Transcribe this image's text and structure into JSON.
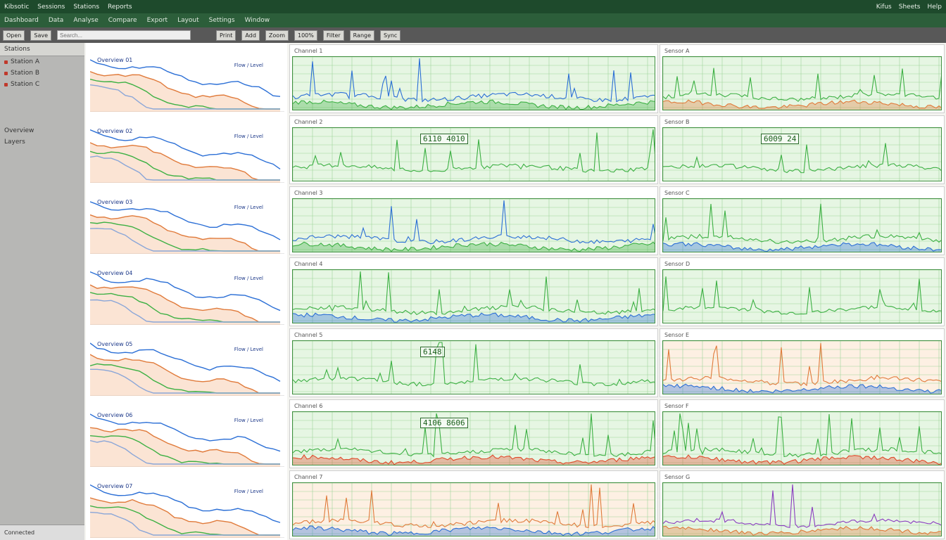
{
  "window": {
    "app_name": "Kibsotic",
    "tabs": [
      "Sessions",
      "Stations",
      "Reports"
    ],
    "right_items": [
      "Kifus",
      "Sheets",
      "Help"
    ]
  },
  "menubar": {
    "items": [
      "Dashboard",
      "Data",
      "Analyse",
      "Compare",
      "Export",
      "Layout",
      "Settings",
      "Window"
    ]
  },
  "toolbar": {
    "search_placeholder": "Search...",
    "buttons": [
      "Open",
      "Save",
      "Print",
      "Add",
      "Zoom",
      "Filter",
      "Range",
      "Sync"
    ],
    "zoom_value": "100%"
  },
  "sidebar": {
    "sections": [
      "Stations"
    ],
    "items": [
      "Station A",
      "Station B",
      "Station C",
      "Overview",
      "Layers"
    ],
    "footer": "Connected"
  },
  "thumbnails": [
    {
      "title": "Overview 01",
      "right": "Flow / Level"
    },
    {
      "title": "Overview 02",
      "right": "Flow / Level"
    },
    {
      "title": "Overview 03",
      "right": "Flow / Level"
    },
    {
      "title": "Overview 04",
      "right": "Flow / Level"
    },
    {
      "title": "Overview 05",
      "right": "Flow / Level"
    },
    {
      "title": "Overview 06",
      "right": "Flow / Level"
    },
    {
      "title": "Overview 07",
      "right": "Flow / Level"
    }
  ],
  "center_panels": [
    {
      "title": "Channel 1",
      "overlay": "",
      "colors": [
        "#2b6fd6",
        "#3cb043"
      ]
    },
    {
      "title": "Channel 2",
      "overlay": "6110  4010",
      "colors": [
        "#3cb043"
      ]
    },
    {
      "title": "Channel 3",
      "overlay": "",
      "colors": [
        "#2b6fd6",
        "#3cb043"
      ]
    },
    {
      "title": "Channel 4",
      "overlay": "",
      "colors": [
        "#3cb043",
        "#2b6fd6"
      ]
    },
    {
      "title": "Channel 5",
      "overlay": "6148",
      "colors": [
        "#3cb043"
      ]
    },
    {
      "title": "Channel 6",
      "overlay": "4106  8606",
      "colors": [
        "#3cb043",
        "#e04a2a"
      ]
    },
    {
      "title": "Channel 7",
      "overlay": "",
      "colors": [
        "#e07a3a",
        "#2b6fd6"
      ]
    }
  ],
  "right_panels": [
    {
      "title": "Sensor A",
      "overlay": "",
      "colors": [
        "#3cb043",
        "#e07a3a"
      ]
    },
    {
      "title": "Sensor B",
      "overlay": "6009 24",
      "colors": [
        "#3cb043"
      ]
    },
    {
      "title": "Sensor C",
      "overlay": "",
      "colors": [
        "#3cb043",
        "#2b6fd6"
      ]
    },
    {
      "title": "Sensor D",
      "overlay": "",
      "colors": [
        "#3cb043"
      ]
    },
    {
      "title": "Sensor E",
      "overlay": "",
      "colors": [
        "#e07a3a",
        "#2b6fd6"
      ]
    },
    {
      "title": "Sensor F",
      "overlay": "",
      "colors": [
        "#3cb043",
        "#e04a2a"
      ]
    },
    {
      "title": "Sensor G",
      "overlay": "",
      "colors": [
        "#8a3cc0",
        "#e07a3a"
      ]
    }
  ]
}
